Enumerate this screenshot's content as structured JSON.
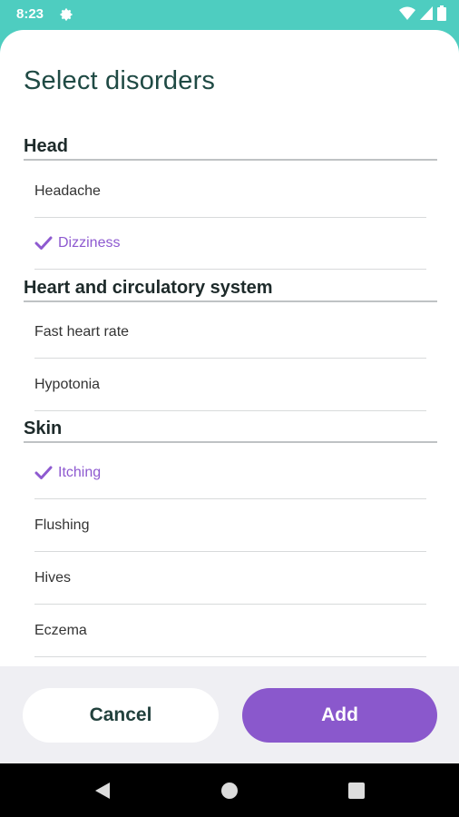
{
  "status": {
    "time": "8:23"
  },
  "dialog": {
    "title": "Select disorders"
  },
  "sections": [
    {
      "header": "Head",
      "items": [
        {
          "label": "Headache",
          "selected": false
        },
        {
          "label": "Dizziness",
          "selected": true
        }
      ]
    },
    {
      "header": "Heart and circulatory system",
      "items": [
        {
          "label": "Fast heart rate",
          "selected": false
        },
        {
          "label": "Hypotonia",
          "selected": false
        }
      ]
    },
    {
      "header": "Skin",
      "items": [
        {
          "label": "Itching",
          "selected": true
        },
        {
          "label": "Flushing",
          "selected": false
        },
        {
          "label": "Hives",
          "selected": false
        },
        {
          "label": "Eczema",
          "selected": false
        }
      ]
    }
  ],
  "buttons": {
    "cancel": "Cancel",
    "add": "Add"
  },
  "colors": {
    "accent": "#8a58cc",
    "teal": "#4ecdc0",
    "title": "#1f4a44"
  }
}
